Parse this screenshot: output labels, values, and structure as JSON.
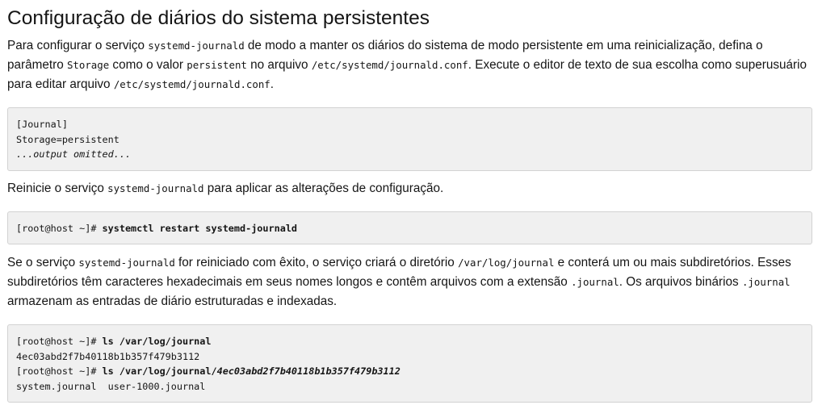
{
  "heading": "Configuração de diários do sistema persistentes",
  "para1": {
    "t1": "Para configurar o serviço ",
    "c1": "systemd-journald",
    "t2": " de modo a manter os diários do sistema de modo persistente em uma reinicialização, defina o parâmetro ",
    "c2": "Storage",
    "t3": " como o valor ",
    "c3": "persistent",
    "t4": " no arquivo ",
    "c4": "/etc/systemd/journald.conf",
    "t5": ". Execute o editor de texto de sua escolha como superusuário para editar arquivo ",
    "c5": "/etc/systemd/journald.conf",
    "t6": "."
  },
  "code1": {
    "line1": "[Journal]",
    "line2": "Storage=persistent",
    "line3": "...output omitted..."
  },
  "para2": {
    "t1": "Reinicie o serviço ",
    "c1": "systemd-journald",
    "t2": " para aplicar as alterações de configuração."
  },
  "code2": {
    "prompt": "[root@host ~]# ",
    "command": "systemctl restart systemd-journald"
  },
  "para3": {
    "t1": "Se o serviço ",
    "c1": "systemd-journald",
    "t2": " for reiniciado com êxito, o serviço criará o diretório ",
    "c2": "/var/log/journal",
    "t3": " e conterá um ou mais subdiretórios. Esses subdiretórios têm caracteres hexadecimais em seus nomes longos e contêm arquivos com a extensão ",
    "c3": ".journal",
    "t4": ". Os arquivos binários ",
    "c4": ".journal",
    "t5": " armazenam as entradas de diário estruturadas e indexadas."
  },
  "code3": {
    "prompt1": "[root@host ~]# ",
    "command1": "ls /var/log/journal",
    "output1": "4ec03abd2f7b40118b1b357f479b3112",
    "prompt2": "[root@host ~]# ",
    "command2": "ls /var/log/journal/",
    "command2_emph": "4ec03abd2f7b40118b1b357f479b3112",
    "output2": "system.journal  user-1000.journal"
  }
}
